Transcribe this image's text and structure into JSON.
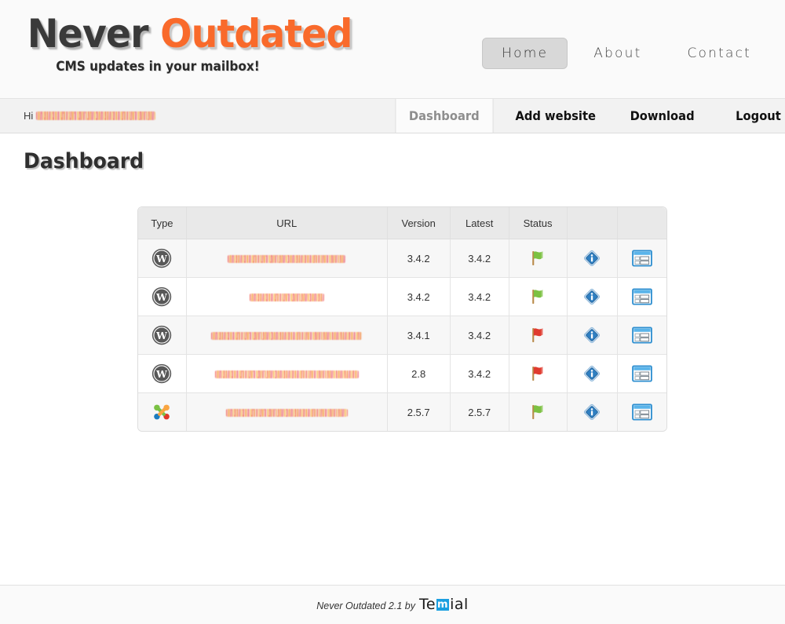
{
  "header": {
    "logo": {
      "part1": "Never",
      "part2": "Outdated",
      "color1": "#3a3a3a",
      "color2": "#f96a2b"
    },
    "tagline": "CMS updates in your mailbox!",
    "nav": [
      {
        "label": "Home",
        "active": true
      },
      {
        "label": "About",
        "active": false
      },
      {
        "label": "Contact",
        "active": false
      }
    ]
  },
  "userbar": {
    "greeting_prefix": "Hi",
    "username_redacted": true,
    "subnav": [
      {
        "label": "Dashboard",
        "active": true
      },
      {
        "label": "Add website",
        "active": false
      },
      {
        "label": "Download",
        "active": false
      },
      {
        "label": "Logout",
        "active": false
      }
    ]
  },
  "page": {
    "title": "Dashboard"
  },
  "table": {
    "columns": [
      "Type",
      "URL",
      "Version",
      "Latest",
      "Status",
      "",
      ""
    ],
    "rows": [
      {
        "type_icon": "wordpress-icon",
        "url_redacted": true,
        "url_width": 150,
        "version": "3.4.2",
        "latest": "3.4.2",
        "status": "flag-green-icon",
        "info": "info-icon",
        "detail": "details-window-icon"
      },
      {
        "type_icon": "wordpress-icon",
        "url_redacted": true,
        "url_width": 95,
        "version": "3.4.2",
        "latest": "3.4.2",
        "status": "flag-green-icon",
        "info": "info-icon",
        "detail": "details-window-icon"
      },
      {
        "type_icon": "wordpress-icon",
        "url_redacted": true,
        "url_width": 192,
        "version": "3.4.1",
        "latest": "3.4.2",
        "status": "flag-red-icon",
        "info": "info-icon",
        "detail": "details-window-icon"
      },
      {
        "type_icon": "wordpress-icon",
        "url_redacted": true,
        "url_width": 183,
        "version": "2.8",
        "latest": "3.4.2",
        "status": "flag-red-icon",
        "info": "info-icon",
        "detail": "details-window-icon"
      },
      {
        "type_icon": "joomla-icon",
        "url_redacted": true,
        "url_width": 155,
        "version": "2.5.7",
        "latest": "2.5.7",
        "status": "flag-green-icon",
        "info": "info-icon",
        "detail": "details-window-icon"
      }
    ]
  },
  "footer": {
    "text": "Never Outdated 2.1 by",
    "brand_part1": "Te",
    "brand_mark": "m",
    "brand_part2": "ial",
    "brand_mark_color": "#1b9fe0"
  },
  "colors": {
    "accent_orange": "#f96a2b",
    "status_ok": "#7cc142",
    "status_outdated": "#e03b2f",
    "icon_blue": "#1b83c9",
    "page_bg": "#ffffff",
    "bar_bg": "#f2f2f2"
  }
}
